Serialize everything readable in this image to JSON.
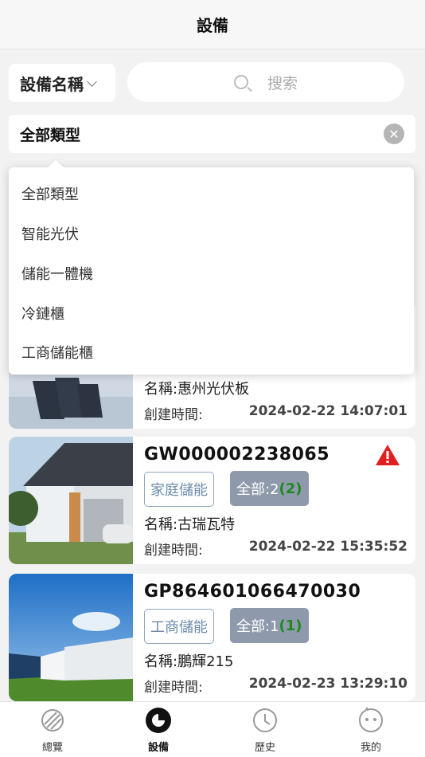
{
  "header": {
    "title": "設備"
  },
  "filter": {
    "field_select": "設備名稱",
    "search_placeholder": "搜索"
  },
  "type_filter": {
    "value": "全部類型"
  },
  "dropdown": {
    "options": [
      "全部類型",
      "智能光伏",
      "儲能一體機",
      "冷鏈櫃",
      "工商儲能櫃"
    ]
  },
  "devices": [
    {
      "name": "名稱:惠州光伏板",
      "created_label": "創建時間:",
      "created": "2024-02-22 14:07:01"
    },
    {
      "sn": "GW000002238065",
      "tag": "家庭儲能",
      "count_prefix": "全部:2",
      "alarm": "(2)",
      "name": "名稱:古瑞瓦特",
      "created_label": "創建時間:",
      "created": "2024-02-22 15:35:52",
      "warning": true
    },
    {
      "sn": "GP864601066470030",
      "tag": "工商儲能",
      "count_prefix": "全部:1",
      "alarm": "(1)",
      "name": "名稱:鵬輝215",
      "created_label": "創建時間:",
      "created": "2024-02-23 13:29:10",
      "warning": false
    }
  ],
  "tabs": [
    {
      "label": "總覽",
      "icon": "overview-icon"
    },
    {
      "label": "設備",
      "icon": "device-icon",
      "active": true
    },
    {
      "label": "歷史",
      "icon": "clock-icon"
    },
    {
      "label": "我的",
      "icon": "profile-icon"
    }
  ],
  "colors": {
    "tag_border": "#8fa6bf",
    "count_bg": "#8e9aab",
    "alarm": "#1e8a1e",
    "warning": "#e02020"
  }
}
